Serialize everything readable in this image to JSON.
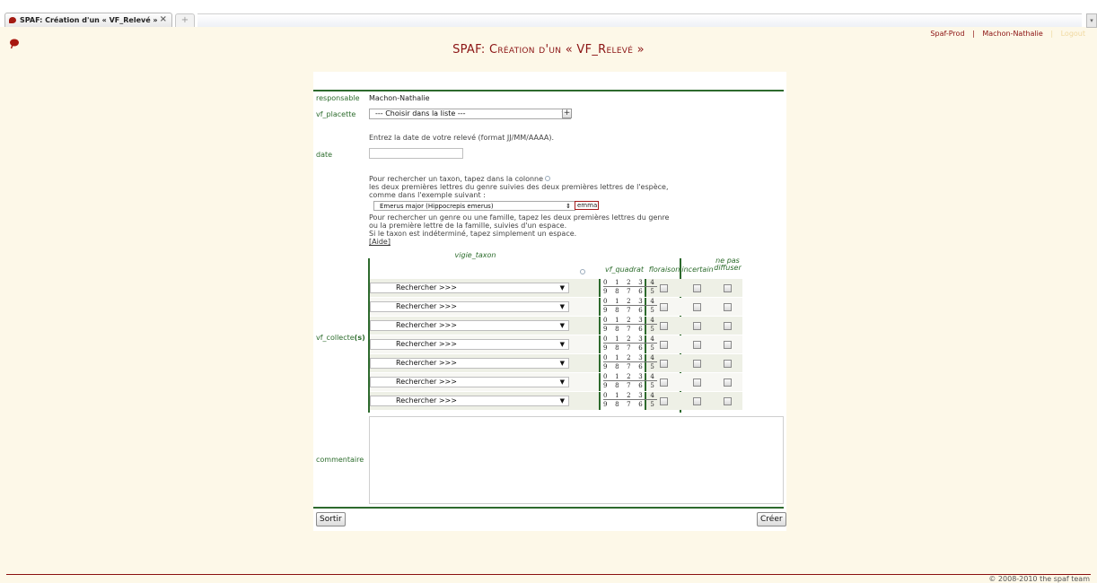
{
  "browser": {
    "tab_title": "SPAF: Création d'un « VF_Relevé »",
    "tab_close": "×",
    "new_tab": "+",
    "scroll_arrow": "▾"
  },
  "header": {
    "links": [
      "Spaf-Prod",
      "|",
      "Machon-Nathalie",
      "|",
      "Logout"
    ],
    "title": "SPAF: Création d'un « VF_Relevé »",
    "accent_color": "#8b1414"
  },
  "form": {
    "responsable_label": "responsable",
    "responsable_value": "Machon-Nathalie",
    "placette_label": "vf_placette",
    "placette_select": "--- Choisir dans la liste ---",
    "placette_add": "+",
    "date_hint": "Entrez la date de votre relevé (format JJ/MM/AAAA).",
    "date_label": "date",
    "date_value": "",
    "help_lines": [
      "Pour rechercher un taxon, tapez dans la colonne",
      "les deux premières lettres du genre suivies des deux premières lettres de l'espèce,",
      "comme dans l'exemple suivant :"
    ],
    "example_select": "Emerus major (Hippocrepis emerus)",
    "example_input": "emma",
    "help_lines_2": [
      "Pour rechercher un genre ou une famille, tapez les deux premières lettres du genre",
      "ou la première lettre de la famille, suivies d'un espace.",
      "Si le taxon est indéterminé, tapez simplement un espace."
    ],
    "aide_link": "[Aide]",
    "collecte_label": "vf_collecte",
    "collecte_suffix": "(s)",
    "columns": {
      "taxon": "vigie_taxon",
      "quadrat": "vf_quadrat",
      "floraison": "floraison",
      "incertain": "incertain",
      "ne_pas_diffuser_1": "ne pas",
      "ne_pas_diffuser_2": "diffuser"
    },
    "rows": [
      {
        "taxon": "Rechercher >>>",
        "q_top": "0 1 2 3 4",
        "q_bot": "9 8 7 6 5"
      },
      {
        "taxon": "Rechercher >>>",
        "q_top": "0 1 2 3 4",
        "q_bot": "9 8 7 6 5"
      },
      {
        "taxon": "Rechercher >>>",
        "q_top": "0 1 2 3 4",
        "q_bot": "9 8 7 6 5"
      },
      {
        "taxon": "Rechercher >>>",
        "q_top": "0 1 2 3 4",
        "q_bot": "9 8 7 6 5"
      },
      {
        "taxon": "Rechercher >>>",
        "q_top": "0 1 2 3 4",
        "q_bot": "9 8 7 6 5"
      },
      {
        "taxon": "Rechercher >>>",
        "q_top": "0 1 2 3 4",
        "q_bot": "9 8 7 6 5"
      },
      {
        "taxon": "Rechercher >>>",
        "q_top": "0 1 2 3 4",
        "q_bot": "9 8 7 6 5"
      }
    ],
    "comment_label": "commentaire",
    "comment_value": ""
  },
  "actions": {
    "exit_label": "Sortir",
    "create_label": "Créer"
  },
  "footer": {
    "copyright": "© 2008-2010 the spaf team"
  }
}
